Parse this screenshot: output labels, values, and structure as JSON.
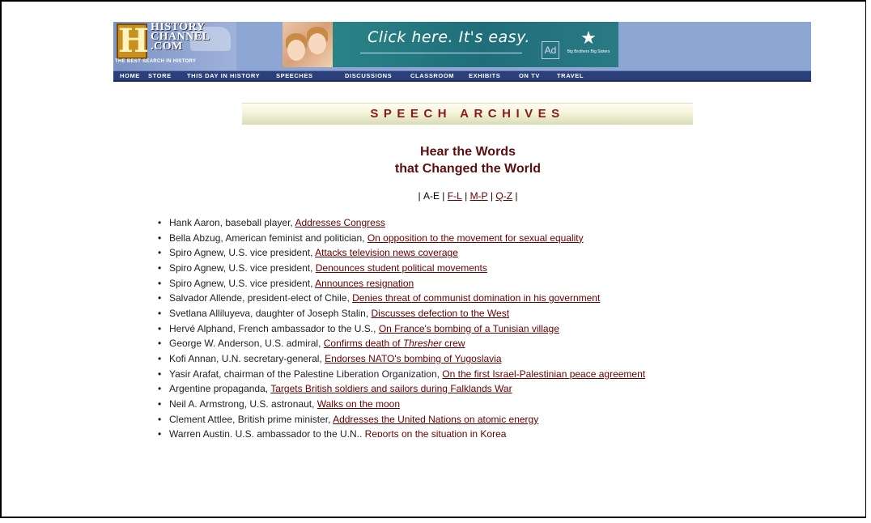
{
  "header": {
    "logo_lines": [
      "HISTORY",
      "CHANNEL",
      ".COM"
    ],
    "logo_letter": "H",
    "logo_tagline": "THE BEST SEARCH IN HISTORY",
    "ad_text": "Click here. It's easy.",
    "ad_badge": "Ad",
    "ad_sponsor": "Big Brothers Big Sisters"
  },
  "nav": [
    "HOME",
    "STORE",
    "THIS DAY IN HISTORY",
    "SPEECHES",
    "DISCUSSIONS",
    "CLASSROOM",
    "EXHIBITS",
    "ON TV",
    "TRAVEL"
  ],
  "section_title": "SPEECH ARCHIVES",
  "headline": {
    "line1": "Hear the Words",
    "line2": "that Changed the World"
  },
  "alpha_nav": {
    "current": "A-E",
    "links": [
      "F-L",
      "M-P",
      "Q-Z"
    ]
  },
  "speeches": [
    {
      "person": "Hank Aaron, baseball player, ",
      "link": "Addresses Congress "
    },
    {
      "person": "Bella Abzug, American feminist and politician, ",
      "link": "On opposition to the movement for sexual equality "
    },
    {
      "person": "Spiro Agnew, U.S. vice president, ",
      "link": "Attacks television news coverage "
    },
    {
      "person": "Spiro Agnew, U.S. vice president, ",
      "link": "Denounces student political movements "
    },
    {
      "person": "Spiro Agnew, U.S. vice president, ",
      "link": "Announces resignation "
    },
    {
      "person": "Salvador Allende, president-elect of Chile, ",
      "link": "Denies threat of communist domination in his government "
    },
    {
      "person": "Svetlana Alliluyeva, daughter of Joseph Stalin, ",
      "link": "Discusses defection to the West "
    },
    {
      "person": "Hervé Alphand, French ambassador to the U.S., ",
      "link": "On France's bombing of a Tunisian village "
    },
    {
      "person": "George W. Anderson, U.S. admiral, ",
      "link": "Confirms death of ",
      "link_italic": "Thresher",
      "link_after": " crew "
    },
    {
      "person": "Kofi Annan, U.N. secretary-general, ",
      "link": "Endorses NATO's bombing of Yugoslavia "
    },
    {
      "person": "Yasir Arafat, chairman of the Palestine Liberation Organization, ",
      "link": "On the first Israel-Palestinian peace agreement "
    },
    {
      "person": "Argentine propaganda, ",
      "link": "Targets British soldiers and sailors during Falklands War "
    },
    {
      "person": "Neil A. Armstrong, U.S. astronaut, ",
      "link": "Walks on the moon "
    },
    {
      "person": "Clement Attlee, British prime minister, ",
      "link": "Addresses the United Nations on atomic energy "
    },
    {
      "person": "Warren Austin, U.S. ambassador to the U.N., ",
      "link": "Reports on the situation in Korea "
    }
  ]
}
